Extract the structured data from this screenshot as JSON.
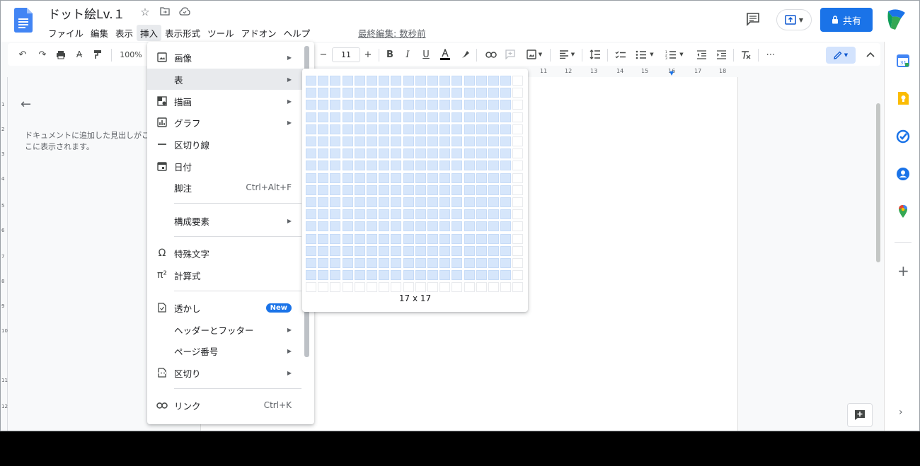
{
  "header": {
    "doc_title": "ドット絵Lv.１",
    "menus": [
      "ファイル",
      "編集",
      "表示",
      "挿入",
      "表示形式",
      "ツール",
      "アドオン",
      "ヘルプ"
    ],
    "active_menu_index": 3,
    "last_edit": "最終編集: 数秒前",
    "share_label": "共有"
  },
  "toolbar": {
    "zoom": "100%",
    "font_size": "11",
    "minus": "−",
    "plus": "+"
  },
  "ruler": [
    "11",
    "12",
    "13",
    "14",
    "15",
    "16",
    "17",
    "18"
  ],
  "vruler": [
    "1",
    "2",
    "3",
    "4",
    "5",
    "6",
    "7",
    "8",
    "9",
    "10",
    "11",
    "12"
  ],
  "outline": {
    "hint": "ドキュメントに追加した見出しがここに表示されます。"
  },
  "insert_menu": {
    "items": [
      {
        "label": "画像",
        "icon": "image-icon",
        "submenu": true
      },
      {
        "label": "表",
        "icon": "",
        "submenu": true,
        "highlighted": true
      },
      {
        "label": "描画",
        "icon": "drawing-icon",
        "submenu": true
      },
      {
        "label": "グラフ",
        "icon": "chart-icon",
        "submenu": true
      },
      {
        "label": "区切り線",
        "icon": "horizontal-line-icon",
        "submenu": false
      },
      {
        "label": "日付",
        "icon": "date-icon",
        "submenu": false
      },
      {
        "label": "脚注",
        "icon": "",
        "shortcut": "Ctrl+Alt+F"
      },
      {
        "label": "構成要素",
        "icon": "",
        "submenu": true
      },
      {
        "label": "特殊文字",
        "icon": "omega-icon",
        "submenu": false
      },
      {
        "label": "計算式",
        "icon": "pi-icon",
        "submenu": false
      },
      {
        "label": "透かし",
        "icon": "watermark-icon",
        "badge": "New"
      },
      {
        "label": "ヘッダーとフッター",
        "icon": "",
        "submenu": true
      },
      {
        "label": "ページ番号",
        "icon": "",
        "submenu": true
      },
      {
        "label": "区切り",
        "icon": "break-icon",
        "submenu": true
      },
      {
        "label": "リンク",
        "icon": "link-icon",
        "shortcut": "Ctrl+K"
      }
    ]
  },
  "table_grid": {
    "selected_cols": 17,
    "selected_rows": 17,
    "total_cols": 18,
    "total_rows": 18,
    "label": "17 x 17"
  },
  "colors": {
    "accent": "#1a73e8",
    "grid_selected": "#d6e6fb"
  }
}
